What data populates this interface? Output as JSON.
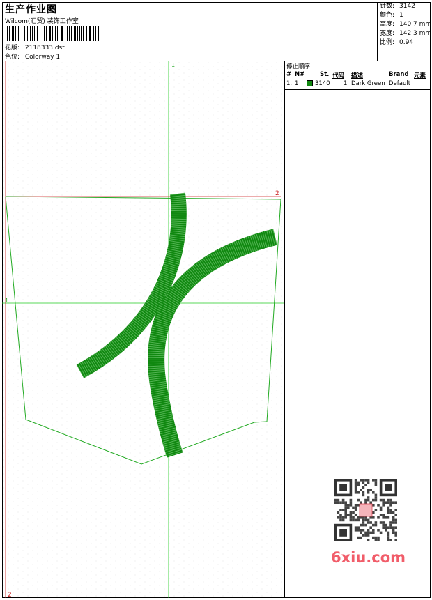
{
  "header": {
    "title": "生产作业图",
    "company": "Wilcom(汇贸) 装饰工作室",
    "design_label": "花版:",
    "design_value": "2118333.dst",
    "colorway_label": "色位:",
    "colorway_value": "Colorway 1"
  },
  "stats": [
    {
      "label": "针数:",
      "value": "3142"
    },
    {
      "label": "颜色:",
      "value": "1"
    },
    {
      "label": "高度:",
      "value": "140.7 mm"
    },
    {
      "label": "宽度:",
      "value": "142.3 mm"
    },
    {
      "label": "比例:",
      "value": "0.94"
    }
  ],
  "canvas": {
    "marker_top_1": "1",
    "marker_left_1": "1",
    "marker_right_2": "2",
    "marker_bottom_2": "2"
  },
  "stop_sequence": {
    "title": "停止顺序:",
    "columns": [
      "#",
      "N#",
      "St.",
      "代码",
      "描述",
      "Brand",
      "元素"
    ],
    "rows": [
      {
        "index": "1.",
        "needle": "1",
        "stitches": "3140",
        "code": "1",
        "description": "Dark Green",
        "brand": "Default",
        "element": ""
      }
    ]
  },
  "colors": {
    "thread": "#108810",
    "guide_green": "#22cc22",
    "guide_red": "#cc2222",
    "watermark": "#f15d6a"
  },
  "watermark": "6xiu.com"
}
